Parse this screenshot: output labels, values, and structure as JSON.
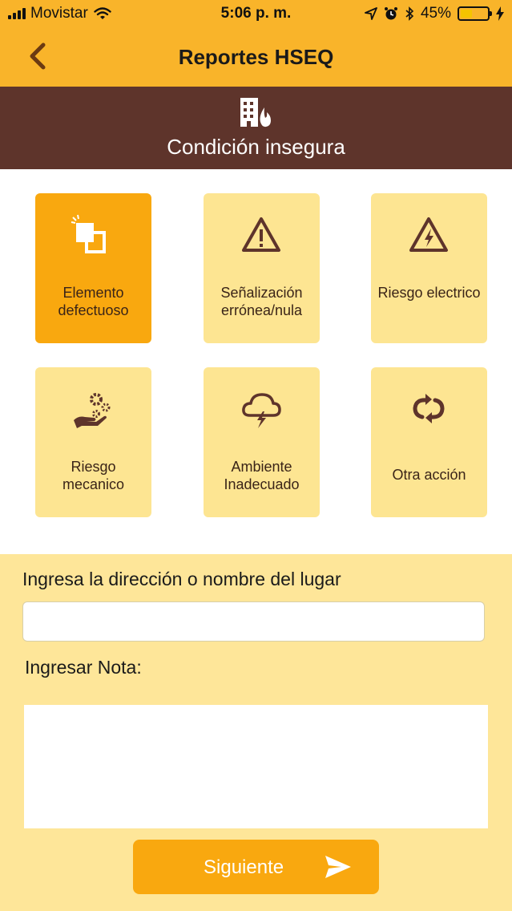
{
  "status_bar": {
    "carrier": "Movistar",
    "time": "5:06 p. m.",
    "battery_percent": "45%",
    "battery_level": 0.45,
    "icons": [
      "signal-icon",
      "wifi-icon",
      "location-icon",
      "alarm-icon",
      "bluetooth-icon",
      "battery-icon",
      "charging-icon"
    ]
  },
  "nav": {
    "title": "Reportes HSEQ",
    "back_icon": "chevron-left-icon"
  },
  "banner": {
    "icon": "building-fire-icon",
    "title": "Condición insegura"
  },
  "categories": [
    {
      "label": "Elemento defectuoso",
      "icon": "broken-element-icon",
      "selected": true
    },
    {
      "label": "Señalización errónea/nula",
      "icon": "warning-triangle-icon",
      "selected": false
    },
    {
      "label": "Riesgo electrico",
      "icon": "electric-warning-icon",
      "selected": false
    },
    {
      "label": "Riesgo mecanico",
      "icon": "hand-gears-icon",
      "selected": false
    },
    {
      "label": "Ambiente Inadecuado",
      "icon": "storm-cloud-icon",
      "selected": false
    },
    {
      "label": "Otra acción",
      "icon": "cycle-arrows-icon",
      "selected": false
    }
  ],
  "form": {
    "address_label": "Ingresa la dirección o nombre del lugar",
    "address_value": "",
    "note_label": "Ingresar Nota:",
    "note_value": "",
    "submit_label": "Siguiente",
    "submit_icon": "send-icon"
  },
  "colors": {
    "accent": "#f9b42a",
    "banner": "#5e342b",
    "tile": "#fde592",
    "tile_selected": "#f9a80f",
    "form_bg": "#fee699"
  }
}
